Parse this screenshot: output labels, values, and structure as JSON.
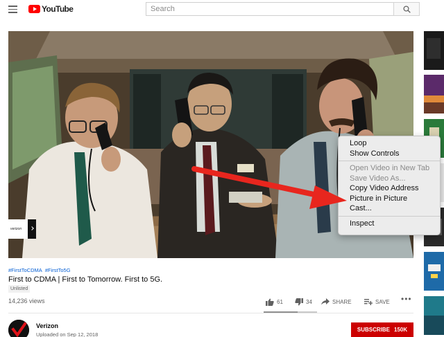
{
  "masthead": {
    "logo_text": "YouTube",
    "search_placeholder": "Search",
    "icons": [
      "menu-icon",
      "youtube-logo",
      "search-icon"
    ]
  },
  "player": {
    "brand_bug": "verizon",
    "icons": [
      "chevron-right-icon"
    ]
  },
  "context_menu": {
    "items": [
      {
        "label": "Loop",
        "enabled": true
      },
      {
        "label": "Show Controls",
        "enabled": true
      },
      {
        "label": "Open Video in New Tab",
        "enabled": false
      },
      {
        "label": "Save Video As...",
        "enabled": false
      },
      {
        "label": "Copy Video Address",
        "enabled": true
      },
      {
        "label": "Picture in Picture",
        "enabled": true
      },
      {
        "label": "Cast...",
        "enabled": true
      },
      {
        "label": "Inspect",
        "enabled": true
      }
    ]
  },
  "annotation": {
    "color": "#e8261e",
    "points_to": "Picture in Picture"
  },
  "video": {
    "hashtags": [
      "#FirstToCDMA",
      "#FirstTo5G"
    ],
    "title": "First to CDMA | First to Tomorrow. First to 5G.",
    "badge": "Unlisted",
    "views": "14,236 views",
    "likes": "61",
    "dislikes": "34",
    "share_label": "SHARE",
    "save_label": "SAVE",
    "more_label": "•••",
    "like_ratio": 0.64
  },
  "channel": {
    "name": "Verizon",
    "uploaded": "Uploaded on Sep 12, 2018",
    "subscribe_label": "SUBSCRIBE",
    "subscriber_count": "150K"
  },
  "colors": {
    "brand_red": "#ff0000",
    "subscribe_red": "#cc0000",
    "link_blue": "#065fd4",
    "text_secondary": "#606060"
  }
}
